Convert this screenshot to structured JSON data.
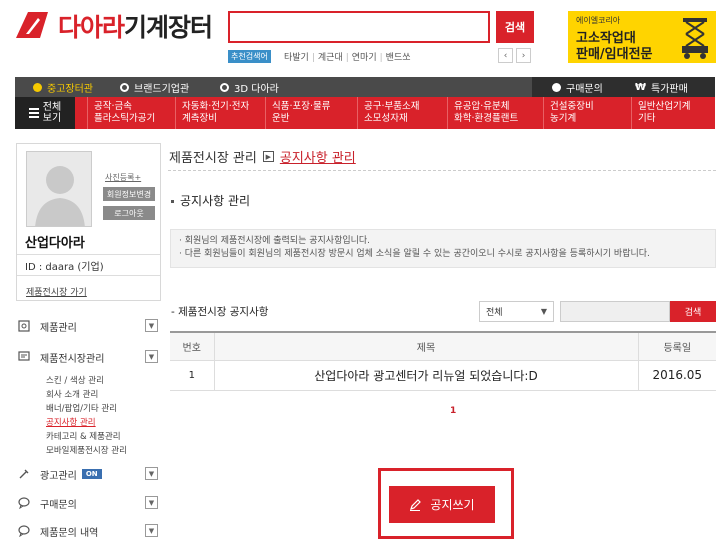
{
  "header": {
    "logo_text_red": "다아라",
    "logo_text_dark": "기계장터",
    "search_value": "",
    "search_button": "검색",
    "rec_tag": "추천검색어",
    "rec_words": [
      "타발기",
      "계근대",
      "연마기",
      "밴드쏘"
    ],
    "prev_icon": "‹",
    "next_icon": "›"
  },
  "ad": {
    "brand": "에이엘코리아",
    "line1": "고소작업대",
    "line2": "판매/임대전문"
  },
  "nav_top": {
    "used": "중고장터관",
    "brand": "브랜드기업관",
    "three_d": "3D 다아라",
    "buy": "구매문의",
    "special": "특가판매"
  },
  "nav_cats": {
    "all_line1": "전체",
    "all_line2": "보기",
    "items": [
      {
        "l1": "공작·금속",
        "l2": "플라스틱가공기"
      },
      {
        "l1": "자동화·전기·전자",
        "l2": "계측장비"
      },
      {
        "l1": "식품·포장·물류",
        "l2": "운반"
      },
      {
        "l1": "공구·부품소재",
        "l2": "소모성자재"
      },
      {
        "l1": "유공압·유분체",
        "l2": "화학·환경플랜트"
      },
      {
        "l1": "건설중장비",
        "l2": "농기계"
      },
      {
        "l1": "일반산업기계",
        "l2": "기타"
      }
    ]
  },
  "profile": {
    "photo_register": "사진등록+",
    "edit_info": "회원정보변경",
    "logout": "로그아웃",
    "company": "산업다아라",
    "id_line": "ID : daara (기업)",
    "store_link": "제품전시장 가기"
  },
  "side_menu": {
    "product_mgmt": "제품관리",
    "store_mgmt": "제품전시장관리",
    "sub": [
      "스킨 / 색상 관리",
      "회사 소개 관리",
      "배너/팝업/기타 관리",
      "공지사항 관리",
      "카테고리 & 제품관리",
      "모바일제품전시장 관리"
    ],
    "ad_mgmt": "광고관리",
    "ad_badge": "ON",
    "purchase_inquiry": "구매문의",
    "product_inquiry_history": "제품문의 내역"
  },
  "main": {
    "crumb_parent": "제품전시장 관리",
    "crumb_current": "공지사항 관리",
    "section_title": "공지사항 관리",
    "info_lines": [
      "· 회원님의 제품전시장에 출력되는 공지사항입니다.",
      "· 다른 회원님들이 회원님의 제품전시장 방문시 업체 소식을 알릴 수 있는 공간이오니 수시로 공지사항을 등록하시기 바랍니다."
    ],
    "list_title": "- 제품전시장 공지사항",
    "filter_value": "전체",
    "filter_search_value": "",
    "filter_button": "검색",
    "columns": {
      "no": "번호",
      "title": "제목",
      "date": "등록일"
    },
    "rows": [
      {
        "no": "1",
        "title": "산업다아라 광고센터가 리뉴얼 되었습니다:D",
        "date": "2016.05"
      }
    ],
    "page": "1",
    "write_button": "공지쓰기"
  },
  "colors": {
    "brand_red": "#d9222a",
    "nav_dark": "#4a4a4a",
    "ad_yellow": "#ffd400",
    "badge_blue": "#3a6fb0"
  }
}
